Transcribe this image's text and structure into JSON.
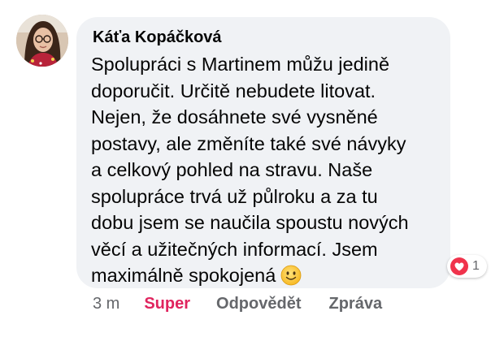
{
  "comment": {
    "author": "Káťa Kopáčková",
    "text": "Spolupráci s Martinem můžu jedině\ndoporučit. Určitě nebudete litovat.\nNejen, že dosáhnete své vysněné\npostavy, ale změníte také své návyky\na celkový pohled na stravu. Naše\nspolupráce trvá už půlroku a za tu\ndobu jsem se naučila spoustu nových\nvěcí a užitečných informací. Jsem\nmaximálně spokojená",
    "emoji": "smiling-face-emoji",
    "reactions": {
      "icon": "heart-icon",
      "count": "1"
    }
  },
  "actions": {
    "timestamp": "3 m",
    "like_label": "Super",
    "reply_label": "Odpovědět",
    "message_label": "Zpráva"
  },
  "colors": {
    "bubble_bg": "#f0f2f5",
    "like_active": "#e0245e",
    "secondary_text": "#65676b",
    "heart": "#f0334c"
  }
}
